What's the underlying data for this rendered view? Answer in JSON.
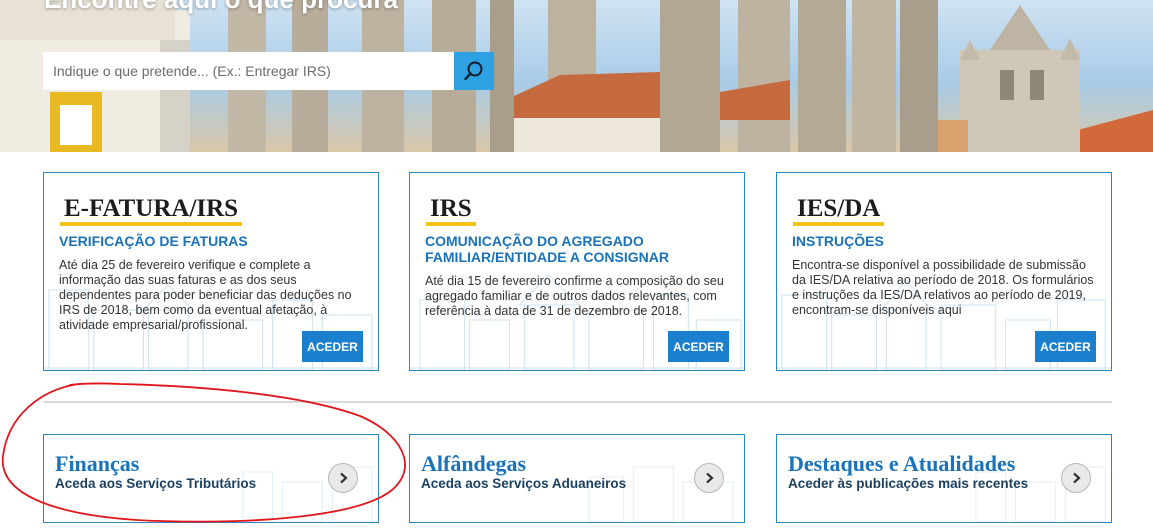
{
  "hero": {
    "title": "Encontre aqui o que procura",
    "search_placeholder": "Indique o que pretende... (Ex.: Entregar IRS)"
  },
  "cards": [
    {
      "title": "E-FATURA/IRS",
      "subtitle": "VERIFICAÇÃO DE FATURAS",
      "text": "Até dia 25 de fevereiro verifique e complete a informação das suas faturas e as dos seus dependentes para poder beneficiar das deduções no IRS de 2018, bem como da eventual afetação, à atividade empresarial/profissional.",
      "button": "ACEDER"
    },
    {
      "title": "IRS",
      "subtitle": "COMUNICAÇÃO DO AGREGADO FAMILIAR/ENTIDADE A CONSIGNAR",
      "text": "Até dia 15 de fevereiro confirme a composição do seu agregado familiar e de outros dados relevantes, com referência à data de 31 de dezembro de 2018.",
      "button": "ACEDER"
    },
    {
      "title": "IES/DA",
      "subtitle": "INSTRUÇÕES",
      "text": "Encontra-se disponível a possibilidade de submissão da IES/DA relativa ao período de 2018. Os formulários e instruções da IES/DA relativos ao período de 2019, encontram-se disponíveis aqui",
      "button": "ACEDER"
    }
  ],
  "links": [
    {
      "title": "Finanças",
      "subtitle": "Aceda aos Serviços Tributários"
    },
    {
      "title": "Alfândegas",
      "subtitle": "Aceda aos Serviços Aduaneiros"
    },
    {
      "title": "Destaques e Atualidades",
      "subtitle": "Aceder às publicações mais recentes"
    }
  ],
  "colors": {
    "accent_blue": "#1a7fcc",
    "title_underline": "#f2c218",
    "annotation_red": "#e0161c"
  }
}
